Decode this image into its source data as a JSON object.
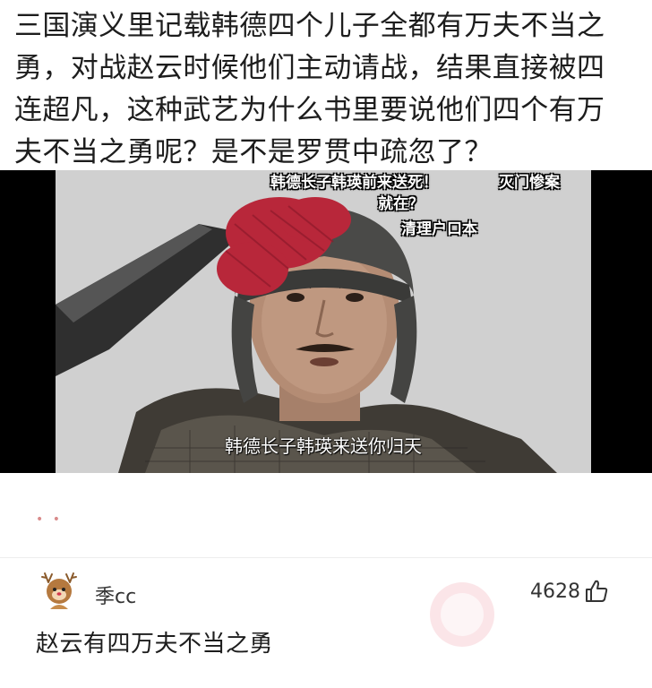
{
  "question": {
    "text": "三国演义里记载韩德四个儿子全都有万夫不当之\n勇，对战赵云时候他们主动请战，结果直接被四\n连超凡，这种武艺为什么书里要说他们四个有万\n夫不当之勇呢？是不是罗贯中疏忽了？"
  },
  "video": {
    "meme_top": "韩德长子韩瑛前来送死！",
    "meme_right": "灭门惨案",
    "meme_mid": "就在？",
    "meme_low": "清理户口本",
    "subtitle": "韩德长子韩瑛来送你归天"
  },
  "reactions": {
    "dots": "• •"
  },
  "comment": {
    "username": "季cc",
    "like_count": "4628",
    "text": "赵云有四万夫不当之勇",
    "avatar_icon": "cartoon-deer-avatar-icon",
    "like_icon": "thumbs-up-icon"
  },
  "colors": {
    "text": "#1d1d1d",
    "video_bg": "#000000",
    "tassel": "#b8273a",
    "reaction_dot": "#d98b8b"
  }
}
